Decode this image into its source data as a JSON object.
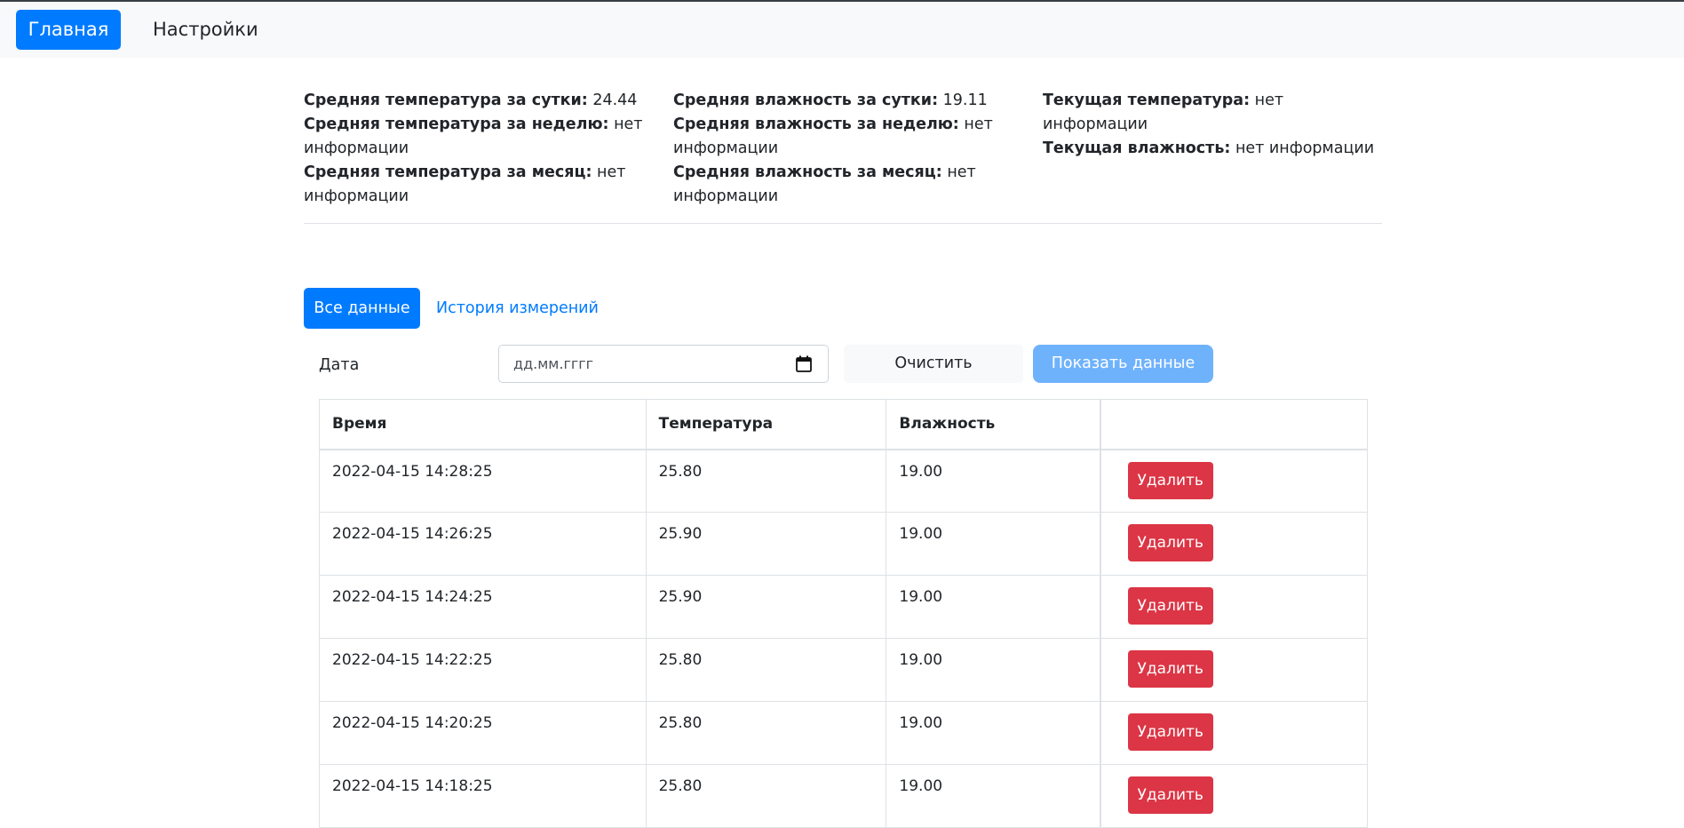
{
  "navbar": {
    "home": "Главная",
    "settings": "Настройки"
  },
  "stats": {
    "col1": [
      {
        "label": "Средняя температура за сутки:",
        "value": "24.44"
      },
      {
        "label": "Средняя температура за неделю:",
        "value": "нет информации"
      },
      {
        "label": "Средняя температура за месяц:",
        "value": "нет информации"
      }
    ],
    "col2": [
      {
        "label": "Средняя влажность за сутки:",
        "value": "19.11"
      },
      {
        "label": "Средняя влажность за неделю:",
        "value": "нет информации"
      },
      {
        "label": "Средняя влажность за месяц:",
        "value": "нет информации"
      }
    ],
    "col3": [
      {
        "label": "Текущая температура:",
        "value": "нет информации"
      },
      {
        "label": "Текущая влажность:",
        "value": "нет информации"
      }
    ]
  },
  "tabs": {
    "all": "Все данные",
    "history": "История измерений"
  },
  "filter": {
    "label": "Дата",
    "placeholder": "дд.мм.гггг",
    "clear": "Очистить",
    "show": "Показать данные"
  },
  "table": {
    "headers": [
      "Время",
      "Температура",
      "Влажность",
      ""
    ],
    "delete_label": "Удалить",
    "rows": [
      {
        "time": "2022-04-15 14:28:25",
        "temp": "25.80",
        "hum": "19.00"
      },
      {
        "time": "2022-04-15 14:26:25",
        "temp": "25.90",
        "hum": "19.00"
      },
      {
        "time": "2022-04-15 14:24:25",
        "temp": "25.90",
        "hum": "19.00"
      },
      {
        "time": "2022-04-15 14:22:25",
        "temp": "25.80",
        "hum": "19.00"
      },
      {
        "time": "2022-04-15 14:20:25",
        "temp": "25.80",
        "hum": "19.00"
      },
      {
        "time": "2022-04-15 14:18:25",
        "temp": "25.80",
        "hum": "19.00"
      }
    ]
  },
  "colors": {
    "primary": "#007bff",
    "danger": "#dc3545",
    "show_button": "#6fb2fc"
  },
  "icons": {
    "calendar": "calendar-icon"
  }
}
